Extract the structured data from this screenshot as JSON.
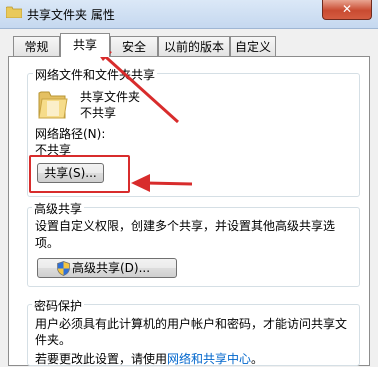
{
  "window": {
    "title": "共享文件夹 属性",
    "close_label": "✕"
  },
  "tabs": [
    {
      "label": "常规"
    },
    {
      "label": "共享"
    },
    {
      "label": "安全"
    },
    {
      "label": "以前的版本"
    },
    {
      "label": "自定义"
    }
  ],
  "network_share": {
    "group_title": "网络文件和文件夹共享",
    "folder_name": "共享文件夹",
    "folder_status": "不共享",
    "path_label": "网络路径(N):",
    "path_value": "不共享",
    "share_button": "共享(S)..."
  },
  "advanced_share": {
    "group_title": "高级共享",
    "description": "设置自定义权限，创建多个共享，并设置其他高级共享选项。",
    "button": "高级共享(D)..."
  },
  "password_protect": {
    "group_title": "密码保护",
    "description": "用户必须具有此计算机的用户帐户和密码，才能访问共享文件夹。",
    "change_text": "若要更改此设置，请使用",
    "change_link": "网络和共享中心",
    "change_suffix": "。"
  },
  "colors": {
    "annotation_red": "#d82c2c",
    "link": "#0066cc",
    "close_button": "#c94b31"
  }
}
